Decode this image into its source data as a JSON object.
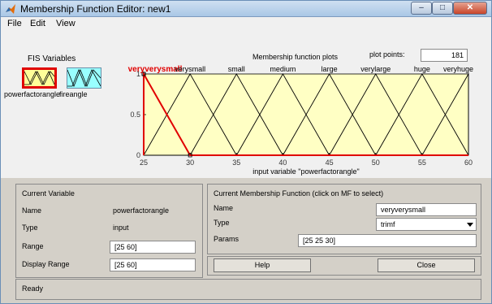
{
  "window": {
    "title": "Membership Function Editor: new1",
    "minimize": "–",
    "maximize": "□",
    "close": "✕"
  },
  "menu": [
    "File",
    "Edit",
    "View"
  ],
  "fis": {
    "label": "FIS Variables",
    "input_name": "powerfactorangle",
    "output_name": "fireangle"
  },
  "plot": {
    "title": "Membership function plots",
    "points_label": "plot points:",
    "points_value": "181",
    "x_label": "input variable \"powerfactorangle\""
  },
  "chart_data": {
    "type": "line",
    "xlim": [
      25,
      60
    ],
    "ylim": [
      0,
      1
    ],
    "x_ticks": [
      25,
      30,
      35,
      40,
      45,
      50,
      55,
      60
    ],
    "y_ticks": [
      0,
      0.5,
      1
    ],
    "series": [
      {
        "name": "veryverysmall",
        "params": [
          25,
          25,
          30
        ],
        "selected": true
      },
      {
        "name": "verysmall",
        "params": [
          25,
          30,
          35
        ]
      },
      {
        "name": "small",
        "params": [
          30,
          35,
          40
        ]
      },
      {
        "name": "medium",
        "params": [
          35,
          40,
          45
        ]
      },
      {
        "name": "large",
        "params": [
          40,
          45,
          50
        ]
      },
      {
        "name": "verylarge",
        "params": [
          45,
          50,
          55
        ]
      },
      {
        "name": "huge",
        "params": [
          50,
          55,
          60
        ]
      },
      {
        "name": "veryhuge",
        "params": [
          55,
          60,
          60
        ]
      }
    ],
    "colors": {
      "background": "#ffffc4",
      "line": "#000000",
      "selected": "#e00000"
    }
  },
  "current_variable": {
    "header": "Current Variable",
    "name_label": "Name",
    "name_value": "powerfactorangle",
    "type_label": "Type",
    "type_value": "input",
    "range_label": "Range",
    "range_value": "[25 60]",
    "display_range_label": "Display Range",
    "display_range_value": "[25 60]"
  },
  "current_mf": {
    "header": "Current Membership Function (click on MF to select)",
    "name_label": "Name",
    "name_value": "veryverysmall",
    "type_label": "Type",
    "type_value": "trimf",
    "params_label": "Params",
    "params_value": "[25 25 30]"
  },
  "buttons": {
    "help": "Help",
    "close": "Close"
  },
  "status": "Ready"
}
